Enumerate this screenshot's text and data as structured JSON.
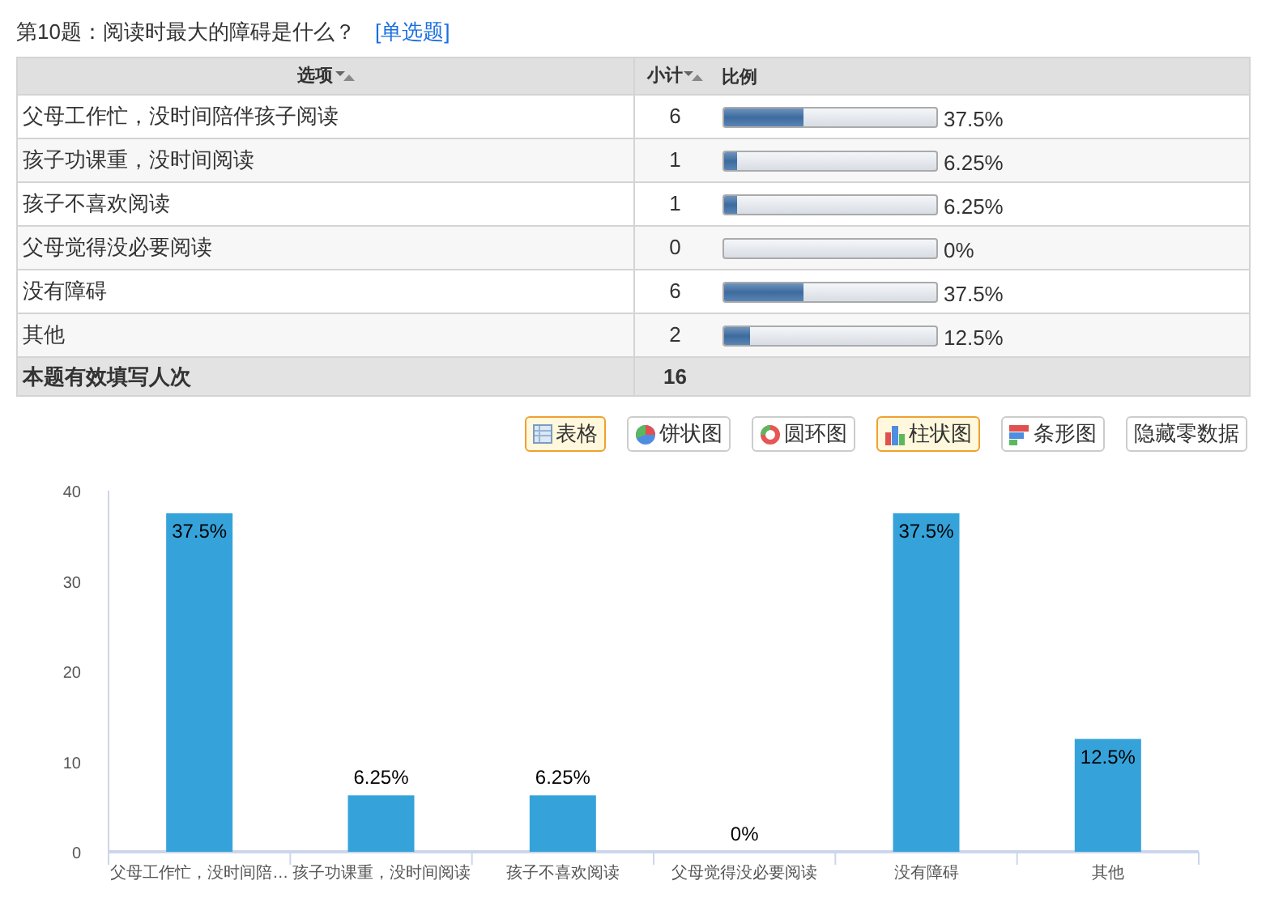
{
  "question": {
    "title": "第10题：阅读时最大的障碍是什么？",
    "type_link": "[单选题]"
  },
  "table": {
    "columns": [
      "选项",
      "小计",
      "比例"
    ],
    "rows": [
      {
        "option": "父母工作忙，没时间陪伴孩子阅读",
        "count": "6",
        "level": 0.375,
        "percent": "37.5%"
      },
      {
        "option": "孩子功课重，没时间阅读",
        "count": "1",
        "level": 0.0625,
        "percent": "6.25%"
      },
      {
        "option": "孩子不喜欢阅读",
        "count": "1",
        "level": 0.0625,
        "percent": "6.25%"
      },
      {
        "option": "父母觉得没必要阅读",
        "count": "0",
        "level": 0,
        "percent": "0%"
      },
      {
        "option": "没有障碍",
        "count": "6",
        "level": 0.375,
        "percent": "37.5%"
      },
      {
        "option": "其他",
        "count": "2",
        "level": 0.125,
        "percent": "12.5%"
      }
    ],
    "footer": {
      "label": "本题有效填写人次",
      "total": "16"
    }
  },
  "view_buttons": [
    {
      "kind": "table",
      "label": "表格",
      "selected": true
    },
    {
      "kind": "pie",
      "label": "饼状图",
      "selected": false
    },
    {
      "kind": "donut",
      "label": "圆环图",
      "selected": false
    },
    {
      "kind": "bar",
      "label": "柱状图",
      "selected": true
    },
    {
      "kind": "hbar",
      "label": "条形图",
      "selected": false
    },
    {
      "kind": "none",
      "label": "隐藏零数据",
      "selected": false
    }
  ],
  "chart_data": {
    "type": "bar",
    "categories": [
      "父母工作忙，没时间陪…",
      "孩子功课重，没时间阅读",
      "孩子不喜欢阅读",
      "父母觉得没必要阅读",
      "没有障碍",
      "其他"
    ],
    "series": [
      {
        "color": "#35a3da",
        "values": [
          37.5,
          6.25,
          6.25,
          0,
          37.5,
          12.5
        ]
      }
    ],
    "ylim": [
      0,
      40
    ],
    "yticks": [
      0,
      10,
      20,
      30,
      40
    ],
    "value_labels": [
      "37.5%",
      "6.25%",
      "6.25%",
      "0%",
      "37.5%",
      "12.5%"
    ]
  }
}
